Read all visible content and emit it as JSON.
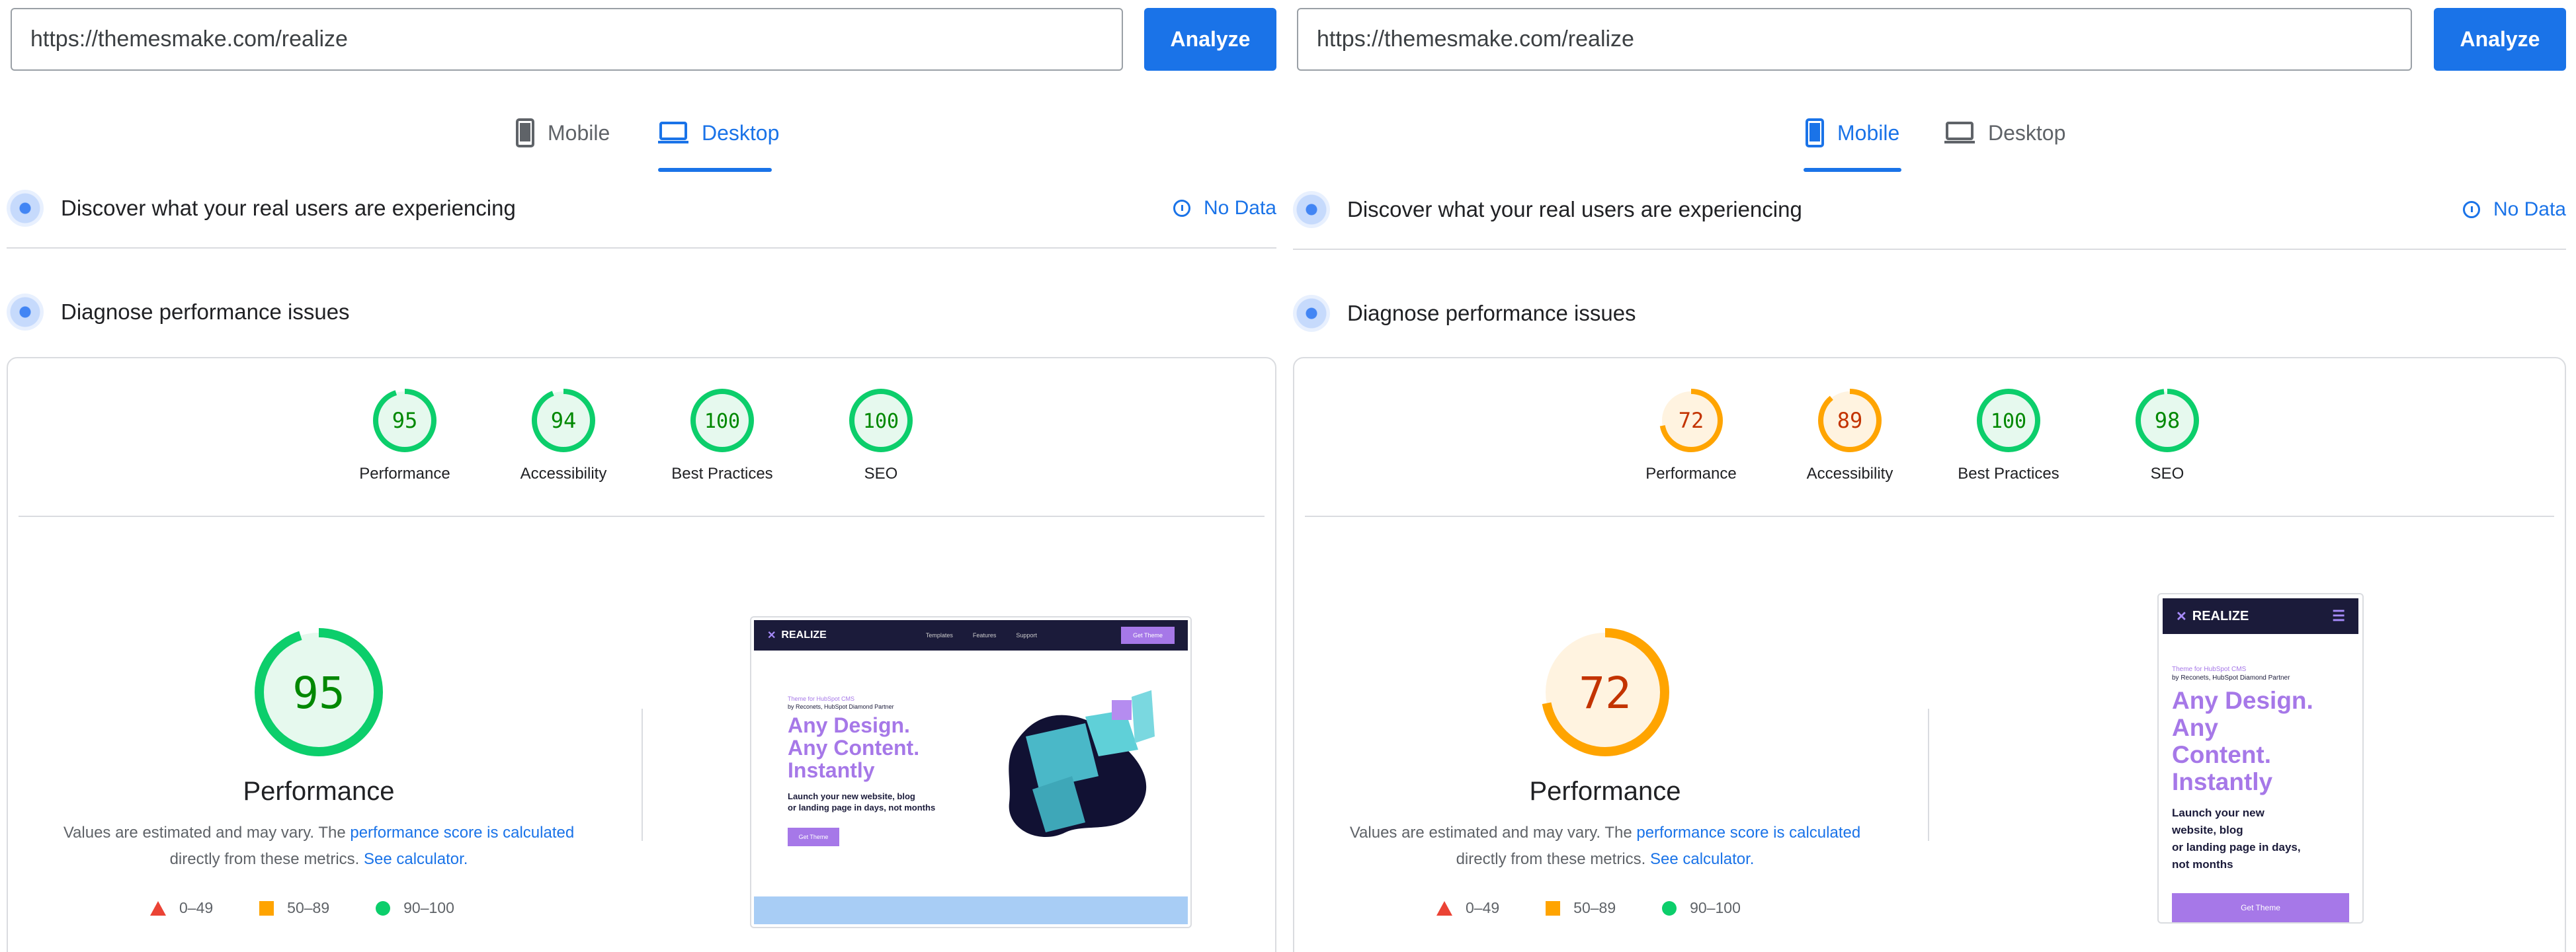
{
  "panels": [
    {
      "url": "https://themesmake.com/realize",
      "analyze_label": "Analyze",
      "tabs": [
        {
          "label": "Mobile",
          "active": false
        },
        {
          "label": "Desktop",
          "active": true
        }
      ],
      "field_section": {
        "title": "Discover what your real users are experiencing",
        "status": "No Data"
      },
      "lab_section": {
        "title": "Diagnose performance issues"
      },
      "scores": [
        {
          "label": "Performance",
          "value": "95"
        },
        {
          "label": "Accessibility",
          "value": "94"
        },
        {
          "label": "Best Practices",
          "value": "100"
        },
        {
          "label": "SEO",
          "value": "100"
        }
      ],
      "big_score": {
        "value": "95",
        "label": "Performance"
      }
    },
    {
      "url": "https://themesmake.com/realize",
      "analyze_label": "Analyze",
      "tabs": [
        {
          "label": "Mobile",
          "active": true
        },
        {
          "label": "Desktop",
          "active": false
        }
      ],
      "field_section": {
        "title": "Discover what your real users are experiencing",
        "status": "No Data"
      },
      "lab_section": {
        "title": "Diagnose performance issues"
      },
      "scores": [
        {
          "label": "Performance",
          "value": "72"
        },
        {
          "label": "Accessibility",
          "value": "89"
        },
        {
          "label": "Best Practices",
          "value": "100"
        },
        {
          "label": "SEO",
          "value": "98"
        }
      ],
      "big_score": {
        "value": "72",
        "label": "Performance"
      }
    }
  ],
  "description": {
    "text1": "Values are estimated and may vary. The ",
    "link1": "performance score is calculated",
    "text2": "directly from these metrics. ",
    "link2": "See calculator."
  },
  "legend": {
    "fail": "0–49",
    "average": "50–89",
    "pass": "90–100"
  },
  "colors": {
    "pass": "#0cce6b",
    "average": "#ffa400",
    "fail": "#ff4e42",
    "accent": "#1a73e8"
  },
  "preview_desktop": {
    "logo": "REALIZE",
    "nav": [
      "Templates",
      "Features",
      "Support"
    ],
    "nav_cta": "Get Theme",
    "eyebrow": "Theme for HubSpot CMS",
    "eyebrow2": "by Reconets, HubSpot Diamond Partner",
    "headline": [
      "Any Design.",
      "Any Content.",
      "Instantly"
    ],
    "sub": [
      "Launch your new website, blog",
      "or landing page in days, not months"
    ],
    "cta": "Get Theme"
  },
  "preview_mobile": {
    "logo": "REALIZE",
    "eyebrow": "Theme for HubSpot CMS",
    "eyebrow2": "by Reconets, HubSpot Diamond Partner",
    "headline": [
      "Any Design.",
      "Any",
      "Content.",
      "Instantly"
    ],
    "sub": [
      "Launch your new",
      "website, blog",
      "or landing page in days,",
      "not months"
    ],
    "cta": "Get Theme"
  }
}
